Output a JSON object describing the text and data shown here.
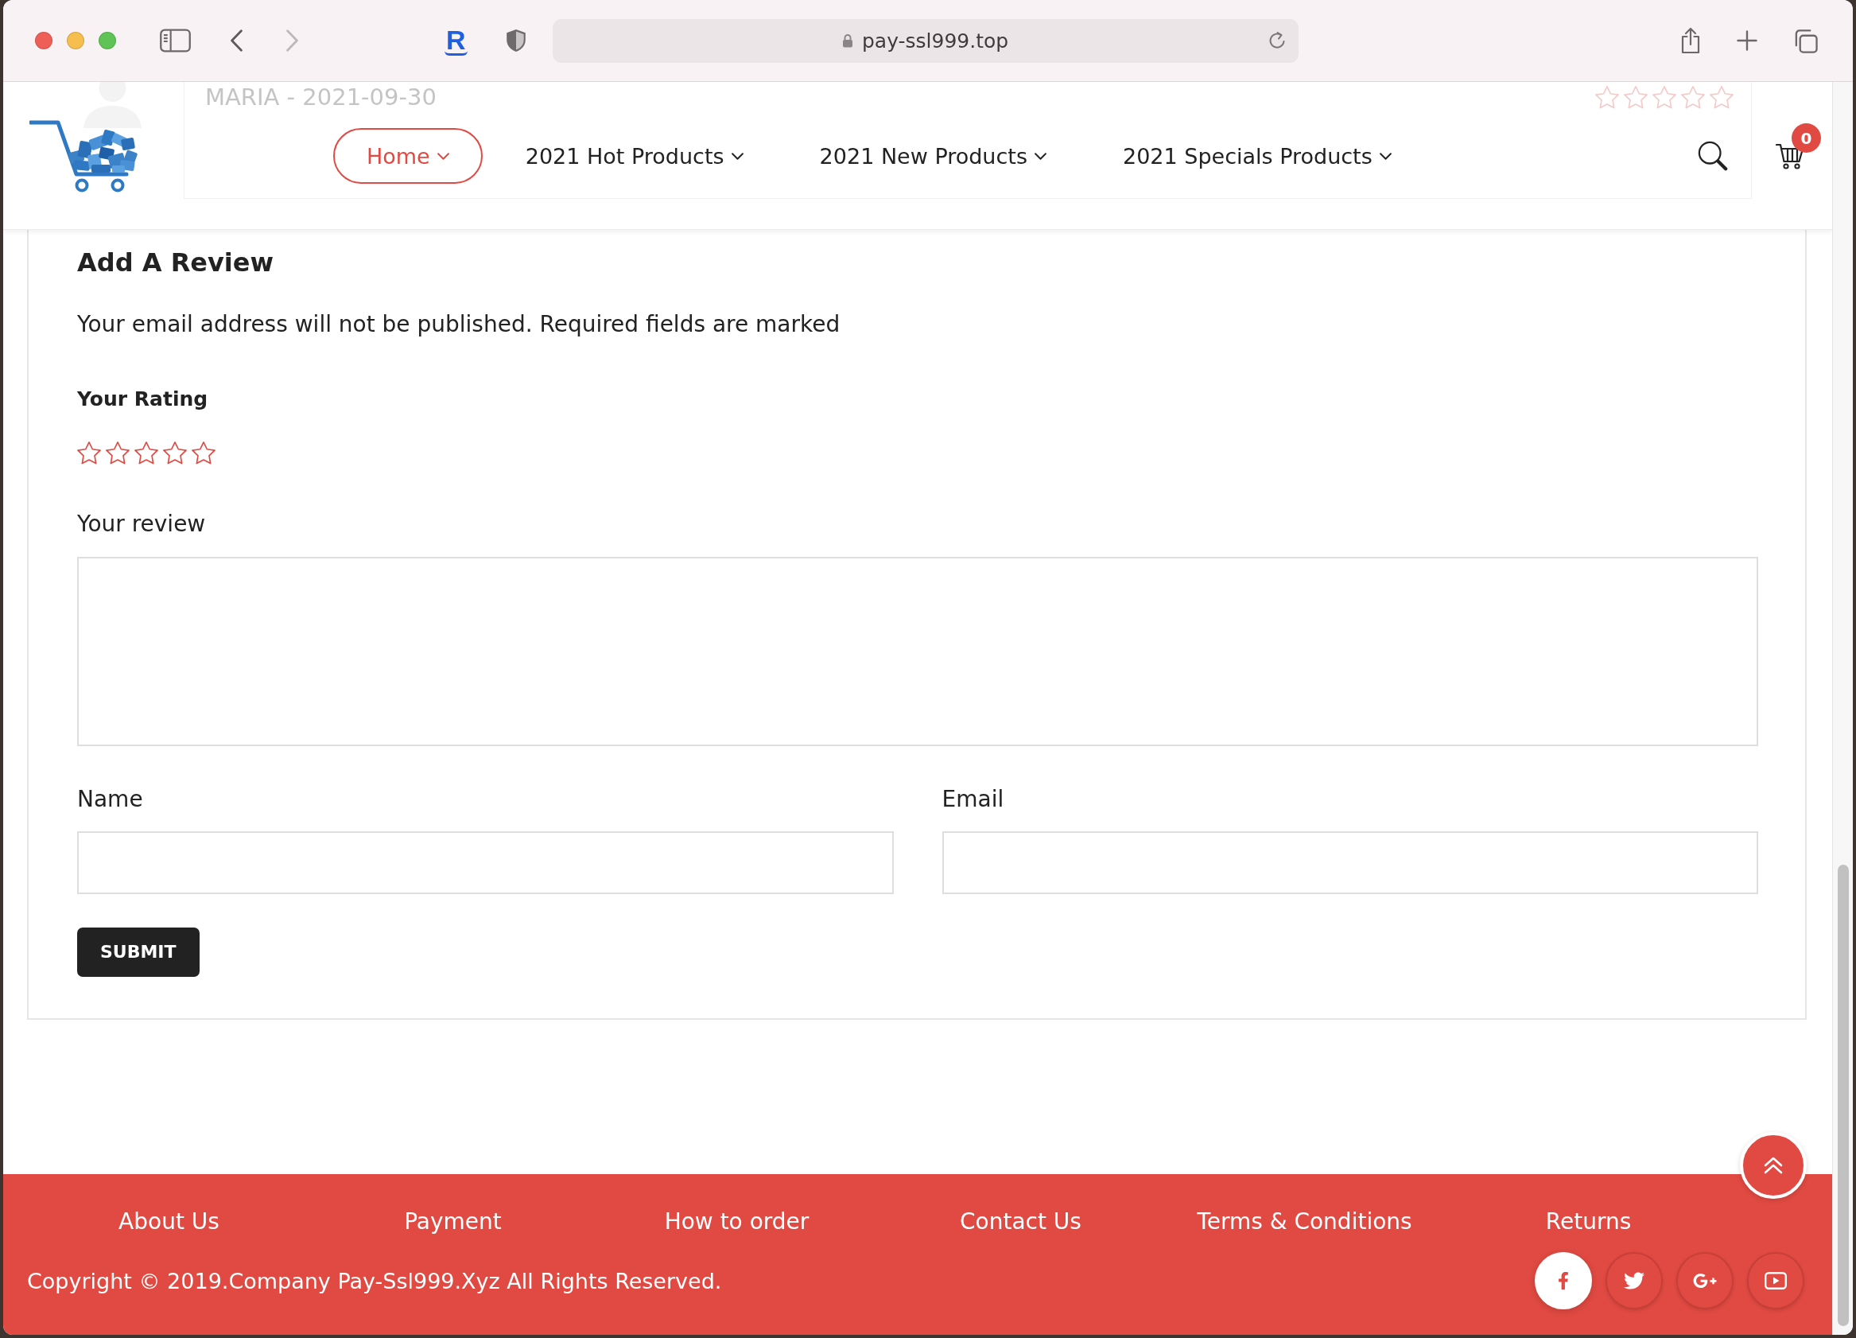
{
  "browser": {
    "back": {
      "disabled": false
    },
    "forward": {
      "disabled": true
    },
    "extension_label": "R",
    "url": "pay-ssl999.top"
  },
  "background_review": {
    "author_date": "MARIA - 2021-09-30",
    "stars": 0
  },
  "header": {
    "menu": [
      {
        "label": "Home",
        "selected": true
      },
      {
        "label": "2021 Hot Products",
        "selected": false
      },
      {
        "label": "2021 New Products",
        "selected": false
      },
      {
        "label": "2021 Specials Products",
        "selected": false
      }
    ],
    "cart_count": "0"
  },
  "review_form": {
    "title": "Add A Review",
    "note": "Your email address will not be published. Required fields are marked",
    "rating_label": "Your Rating",
    "rating": {
      "stars": 0
    },
    "review_label": "Your review",
    "fields": [
      {
        "label": "Name"
      },
      {
        "label": "Email"
      }
    ],
    "submit_label": "SUBMIT"
  },
  "footer": {
    "links": [
      "About Us",
      "Payment",
      "How to order",
      "Contact Us",
      "Terms & Conditions",
      "Returns"
    ],
    "copyright": "Copyright © 2019.Company Pay-Ssl999.Xyz All Rights Reserved.",
    "social": [
      {
        "highlighted": true
      },
      {
        "highlighted": false
      },
      {
        "highlighted": false
      },
      {
        "highlighted": false
      }
    ]
  }
}
